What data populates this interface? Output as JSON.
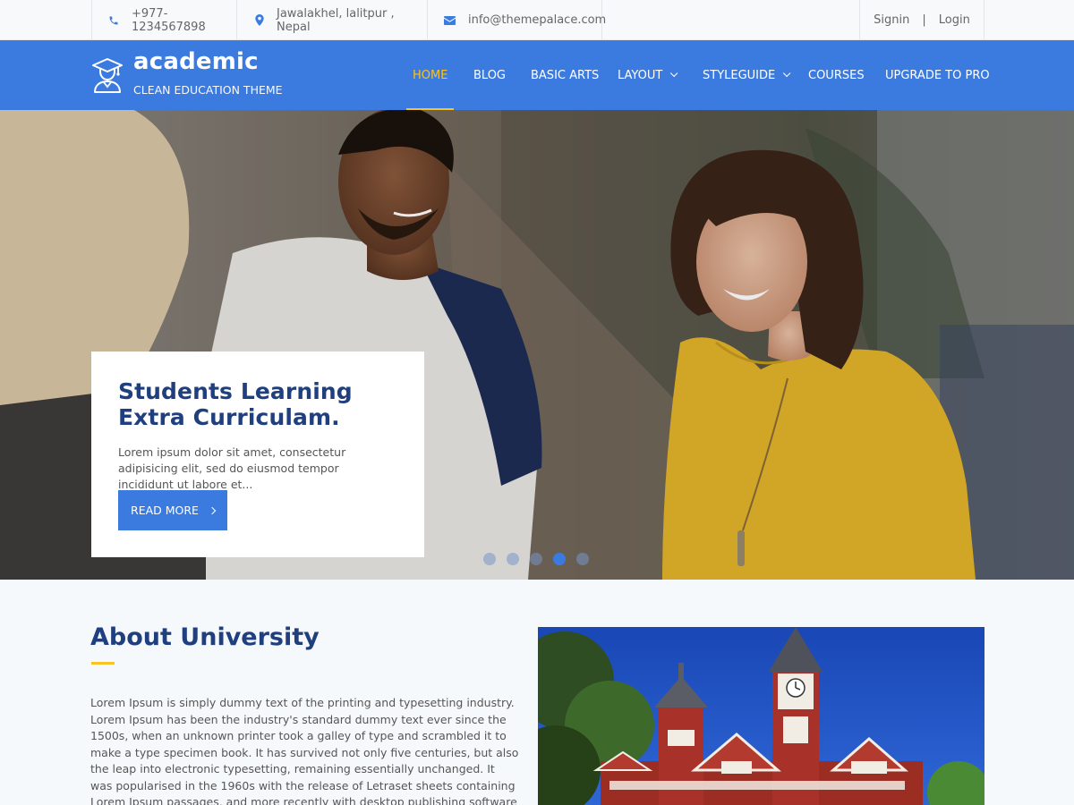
{
  "topbar": {
    "phone": "+977-1234567898",
    "location": "Jawalakhel, lalitpur , Nepal",
    "email": "info@themepalace.com",
    "signin": "Signin",
    "separator": "|",
    "login": "Login"
  },
  "header": {
    "site_title": "academic",
    "tagline": "CLEAN EDUCATION THEME"
  },
  "nav": [
    {
      "label": "HOME",
      "active": true
    },
    {
      "label": "BLOG"
    },
    {
      "label": "BASIC ARTS"
    },
    {
      "label": "LAYOUT",
      "dropdown": true
    },
    {
      "label": "STYLEGUIDE",
      "dropdown": true
    },
    {
      "label": "COURSES"
    },
    {
      "label": "UPGRADE TO PRO"
    }
  ],
  "hero": {
    "title_line1": "Students Learning",
    "title_line2": "Extra Curriculam.",
    "text": "Lorem ipsum dolor sit amet, consectetur adipisicing elit, sed do eiusmod tempor incididunt ut labore et...",
    "button": "READ MORE",
    "slide_count": 5,
    "active_slide": 4
  },
  "about": {
    "title": "About University",
    "text": "Lorem Ipsum is simply dummy text of the printing and typesetting industry. Lorem Ipsum has been the industry's standard dummy text ever since the 1500s, when an unknown printer took a galley of type and scrambled it to make a type specimen book. It has survived not only five centuries, but also the leap into electronic typesetting, remaining essentially unchanged. It was popularised in the 1960s with the release of Letraset sheets containing Lorem Ipsum passages, and more recently with desktop publishing software like Aldus PageMaker including versions of Lorem"
  },
  "colors": {
    "primary": "#3b7be0",
    "accent": "#f7c325",
    "heading": "#1f3f7e"
  },
  "icons": {
    "phone": "phone-icon",
    "location": "map-marker-icon",
    "email": "envelope-icon",
    "logo": "graduate-icon",
    "dropdown": "chevron-down-icon",
    "button_arrow": "chevron-right-icon"
  }
}
